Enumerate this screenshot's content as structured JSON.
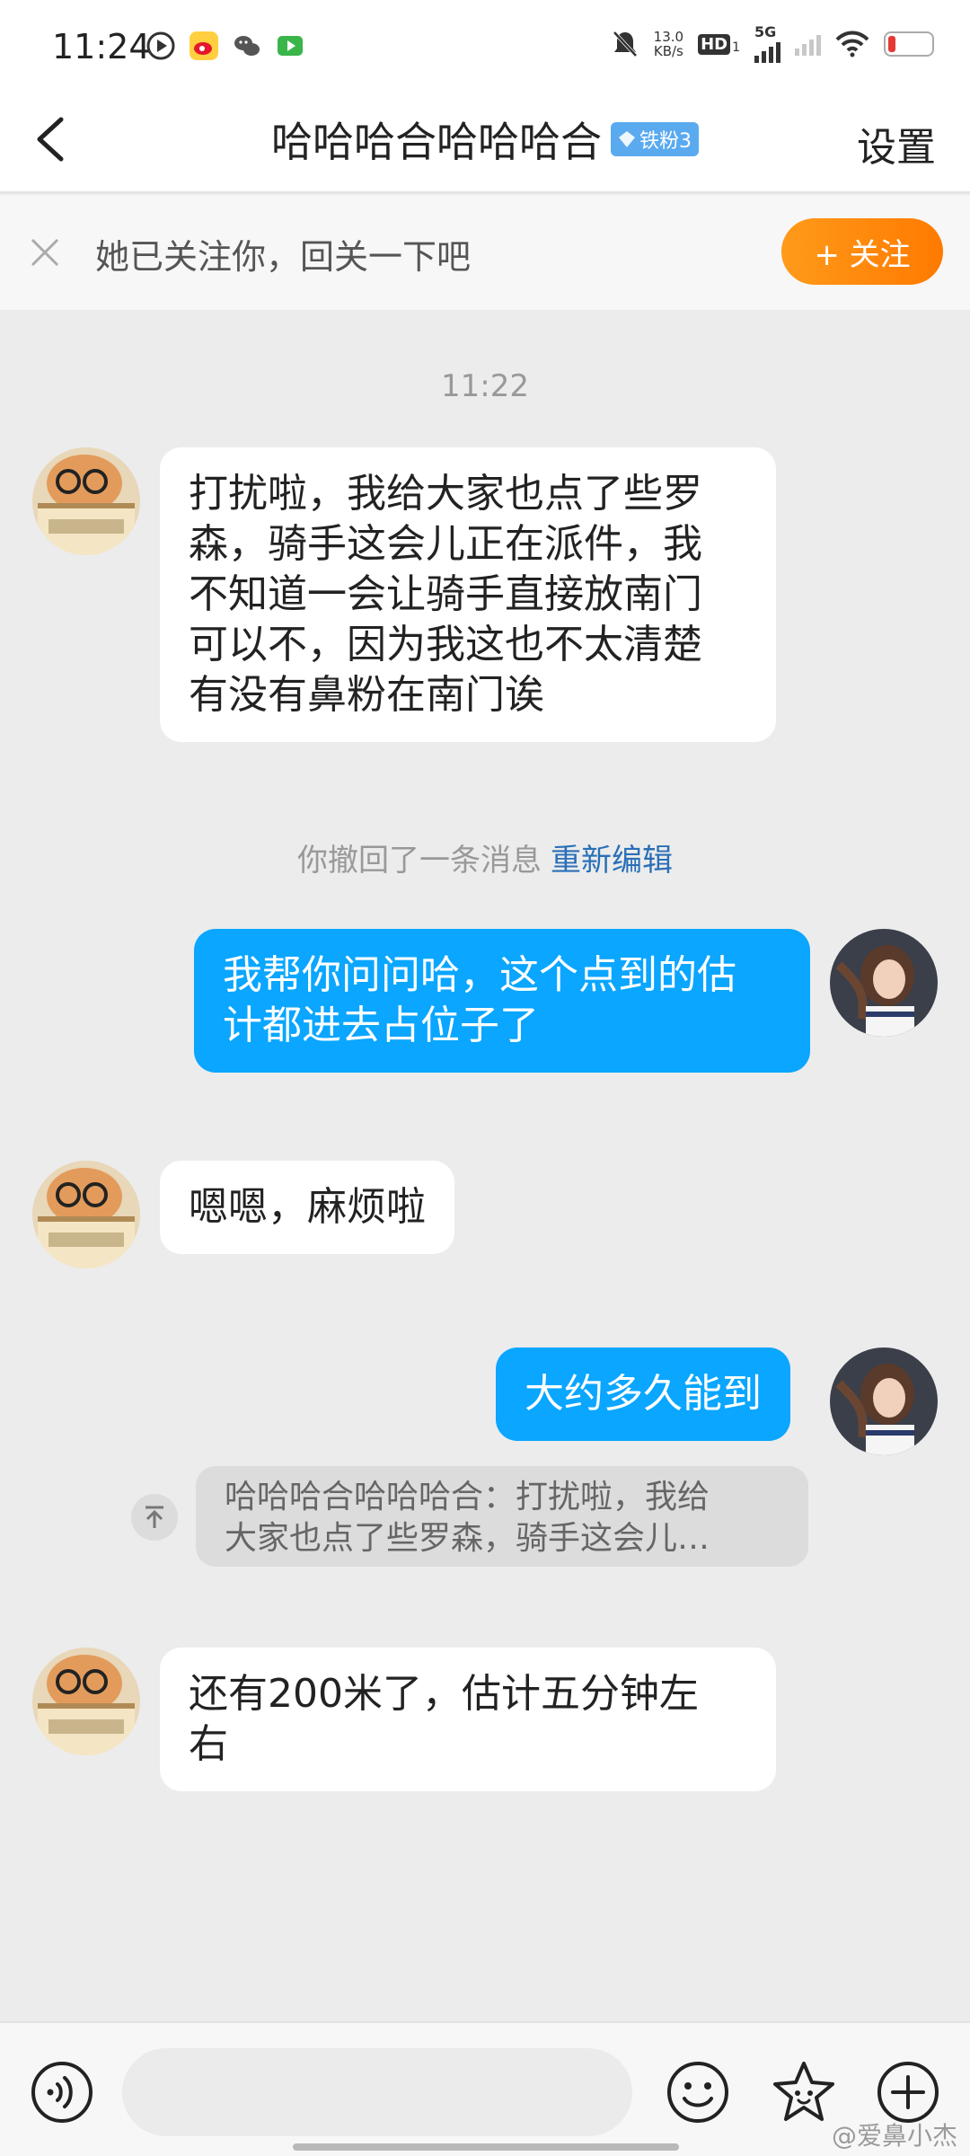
{
  "status_bar": {
    "time": "11:24",
    "speed_value": "13.0",
    "speed_unit": "KB/s",
    "hd": "HD",
    "hd_sub": "1",
    "net": "5G"
  },
  "header": {
    "title": "哈哈哈合哈哈哈合",
    "badge": "铁粉3",
    "settings": "设置"
  },
  "follow_bar": {
    "text": "她已关注你，回关一下吧",
    "button": "+ 关注"
  },
  "chat": {
    "time_label": "11:22",
    "messages": [
      {
        "side": "in",
        "lines": [
          "打扰啦，我给大家也点了些罗",
          "森，骑手这会儿正在派件，我",
          "不知道一会让骑手直接放南门",
          "可以不，因为我这也不太清楚",
          "有没有鼻粉在南门诶"
        ]
      },
      {
        "side": "out",
        "lines": [
          "我帮你问问哈，这个点到的估",
          "计都进去占位子了"
        ]
      },
      {
        "side": "in",
        "lines": [
          "嗯嗯，麻烦啦"
        ]
      },
      {
        "side": "out",
        "lines": [
          "大约多久能到"
        ]
      },
      {
        "side": "in",
        "lines": [
          "还有200米了，估计五分钟左",
          "右"
        ]
      }
    ],
    "recall_text": "你撤回了一条消息",
    "recall_link": "重新编辑",
    "quote_lines": [
      "哈哈哈合哈哈哈合：打扰啦，我给",
      "大家也点了些罗森，骑手这会儿…"
    ],
    "quote_icon": "↑"
  },
  "watermark": "@爱鼻小杰",
  "colors": {
    "accent_blue": "#0aa6ff",
    "follow_orange": "#ff8a00",
    "link_blue": "#2a6fb8"
  }
}
